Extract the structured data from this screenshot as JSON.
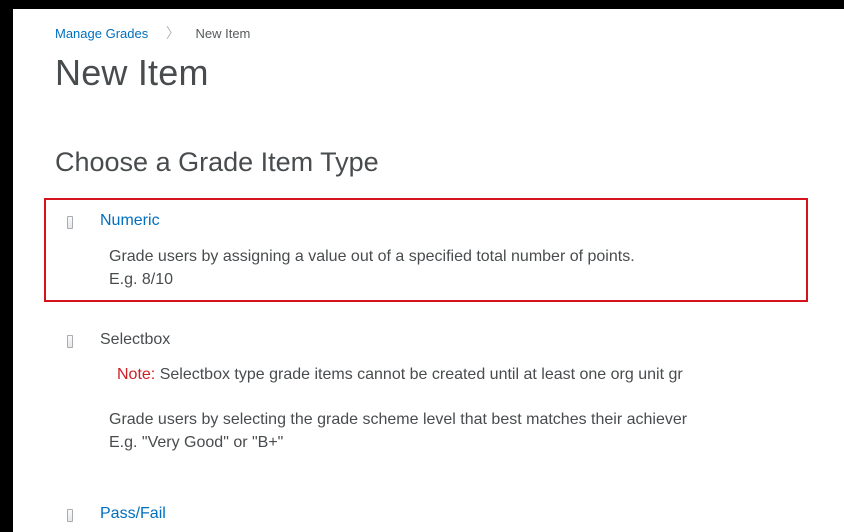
{
  "breadcrumb": {
    "parent": "Manage Grades",
    "separator": "〉",
    "current": "New Item"
  },
  "page_title": "New Item",
  "section_title": "Choose a Grade Item Type",
  "grade_types": [
    {
      "label": "Numeric",
      "description_line1": "Grade users by assigning a value out of a specified total number of points.",
      "description_line2": "E.g. 8/10"
    },
    {
      "label": "Selectbox",
      "note_label": "Note:",
      "note_text": " Selectbox type grade items cannot be created until at least one org unit gr",
      "description_line1": "Grade users by selecting the grade scheme level that best matches their achiever",
      "description_line2": "E.g. \"Very Good\" or \"B+\""
    },
    {
      "label": "Pass/Fail"
    }
  ],
  "colors": {
    "link": "#006fbf",
    "text": "#494c4e",
    "note": "#cd2026",
    "highlight_border": "#d3141c"
  }
}
